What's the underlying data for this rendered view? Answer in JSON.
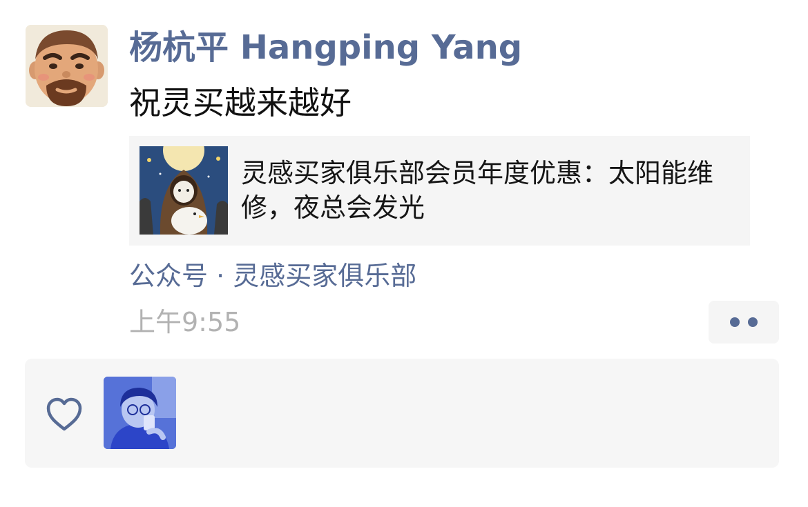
{
  "post": {
    "author": "杨杭平 Hangping Yang",
    "text": "祝灵买越来越好",
    "link": {
      "title": "灵感买家俱乐部会员年度优惠：太阳能维修，夜总会发光"
    },
    "source": "公众号 · 灵感买家俱乐部",
    "time": "上午9:55"
  },
  "icons": {
    "more": "more-dots-icon",
    "like": "heart-icon"
  },
  "colors": {
    "link_blue": "#576b95",
    "time_gray": "#b2b2b2",
    "panel_bg": "#f6f6f6"
  }
}
